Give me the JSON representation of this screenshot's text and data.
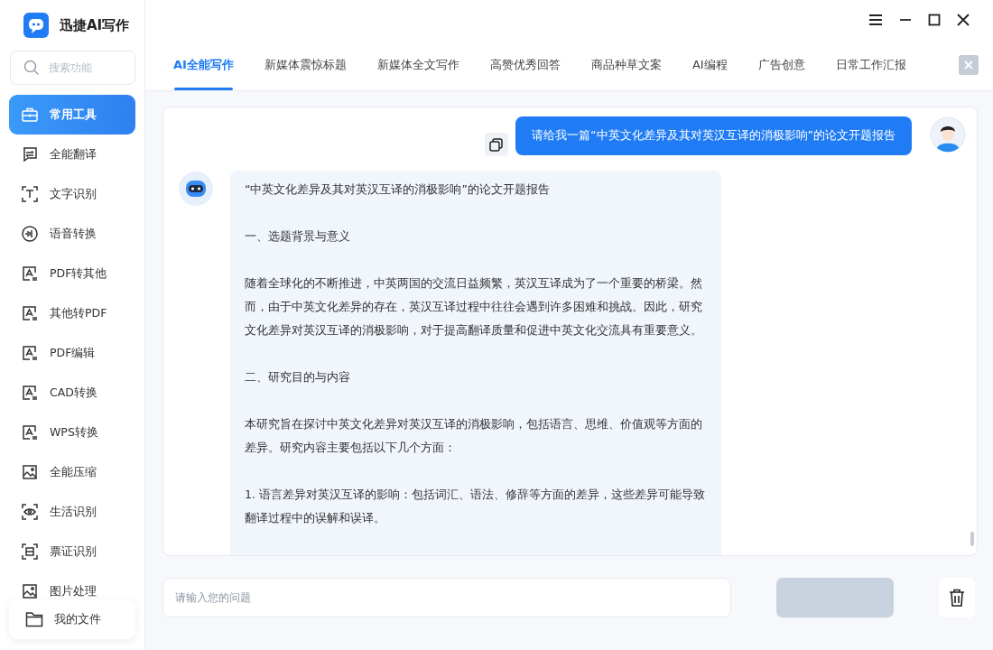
{
  "app": {
    "title": "迅捷AI写作"
  },
  "search": {
    "placeholder": "搜索功能"
  },
  "sidebar": {
    "items": [
      {
        "label": "常用工具",
        "selected": true
      },
      {
        "label": "全能翻译",
        "selected": false
      },
      {
        "label": "文字识别",
        "selected": false
      },
      {
        "label": "语音转换",
        "selected": false
      },
      {
        "label": "PDF转其他",
        "selected": false
      },
      {
        "label": "其他转PDF",
        "selected": false
      },
      {
        "label": "PDF编辑",
        "selected": false
      },
      {
        "label": "CAD转换",
        "selected": false
      },
      {
        "label": "WPS转换",
        "selected": false
      },
      {
        "label": "全能压缩",
        "selected": false
      },
      {
        "label": "生活识别",
        "selected": false
      },
      {
        "label": "票证识别",
        "selected": false
      },
      {
        "label": "图片处理",
        "selected": false
      }
    ],
    "my_files": "我的文件"
  },
  "tabs": [
    {
      "label": "AI全能写作",
      "selected": true
    },
    {
      "label": "新媒体震惊标题",
      "selected": false
    },
    {
      "label": "新媒体全文写作",
      "selected": false
    },
    {
      "label": "高赞优秀回答",
      "selected": false
    },
    {
      "label": "商品种草文案",
      "selected": false
    },
    {
      "label": "AI编程",
      "selected": false
    },
    {
      "label": "广告创意",
      "selected": false
    },
    {
      "label": "日常工作汇报",
      "selected": false
    }
  ],
  "chat": {
    "user_message": "请给我一篇“中英文化差异及其对英汉互译的消极影响”的论文开题报告",
    "reply_paragraphs": [
      "“中英文化差异及其对英汉互译的消极影响”的论文开题报告",
      "一、选题背景与意义",
      "随着全球化的不断推进，中英两国的交流日益频繁，英汉互译成为了一个重要的桥梁。然而，由于中英文化差异的存在，英汉互译过程中往往会遇到许多困难和挑战。因此，研究文化差异对英汉互译的消极影响，对于提高翻译质量和促进中英文化交流具有重要意义。",
      "二、研究目的与内容",
      "本研究旨在探讨中英文化差异对英汉互译的消极影响，包括语言、思维、价值观等方面的差异。研究内容主要包括以下几个方面：",
      "1. 语言差异对英汉互译的影响：包括词汇、语法、修辞等方面的差异，这些差异可能导致翻译过程中的误解和误译。"
    ]
  },
  "input": {
    "placeholder": "请输入您的问题"
  },
  "send_button": {
    "disabled": true
  }
}
